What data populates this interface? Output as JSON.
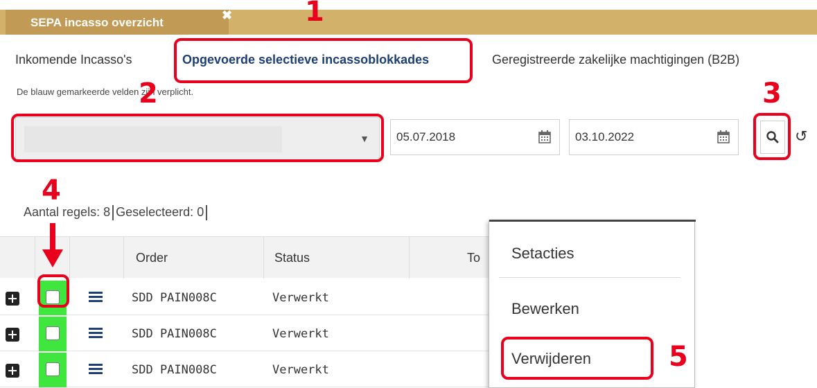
{
  "window": {
    "tab_title": "SEPA incasso overzicht",
    "close_glyph": "✖"
  },
  "subtabs": [
    {
      "label": "Inkomende Incasso's"
    },
    {
      "label": "Opgevoerde selectieve incassoblokkades"
    },
    {
      "label": "Geregistreerde zakelijke machtigingen (B2B)"
    }
  ],
  "hint": "De blauw gemarkeerde velden zijn verplicht.",
  "filters": {
    "account_select": {
      "value": "",
      "arrow_icon": "caret-down-icon"
    },
    "date_from": "05.07.2018",
    "date_to": "03.10.2022",
    "search_icon": "search-icon",
    "reset_icon": "reset-icon",
    "reset_glyph": "↺"
  },
  "summary": {
    "rows_label": "Aantal regels:",
    "rows_value": "8",
    "selected_label": "Geselecteerd:",
    "selected_value": "0"
  },
  "table": {
    "headers": [
      "Order",
      "Status",
      "To"
    ],
    "rows": [
      {
        "order": "SDD PAIN008C",
        "status": "Verwerkt"
      },
      {
        "order": "SDD PAIN008C",
        "status": "Verwerkt"
      },
      {
        "order": "SDD PAIN008C",
        "status": "Verwerkt"
      }
    ]
  },
  "context_menu": {
    "title": "Setacties",
    "items": [
      "Bewerken",
      "Verwijderen"
    ]
  },
  "annotations": [
    "1",
    "2",
    "3",
    "4",
    "5"
  ],
  "colors": {
    "topbar": "#d2b26a",
    "active_tab": "#c19a55",
    "annotation": "#e8001c",
    "checkbox_highlight": "#3ee63e",
    "link_blue": "#1d3f73"
  }
}
